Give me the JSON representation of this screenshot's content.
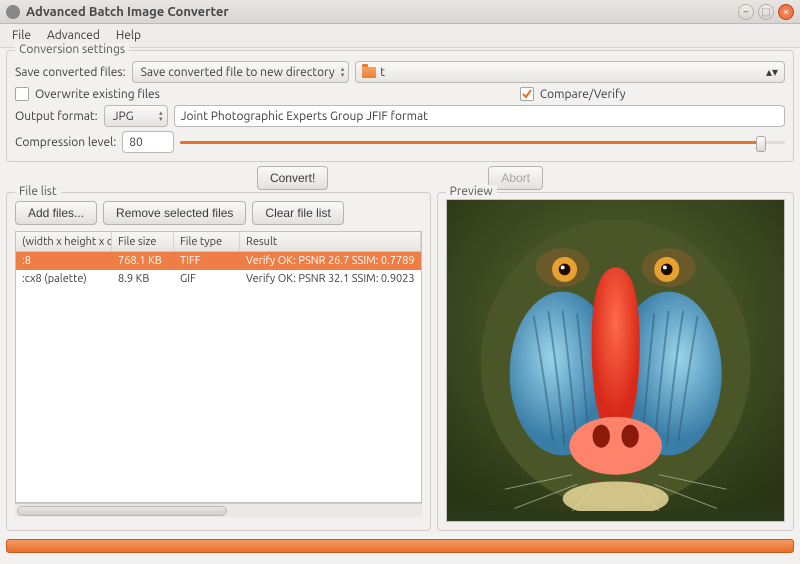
{
  "window": {
    "title": "Advanced Batch Image Converter"
  },
  "menu": {
    "file": "File",
    "advanced": "Advanced",
    "help": "Help"
  },
  "settings": {
    "legend": "Conversion settings",
    "save_label": "Save converted files:",
    "save_mode": "Save converted file to new directory",
    "path_display": "t",
    "overwrite_label": "Overwrite existing files",
    "overwrite_checked": false,
    "compare_label": "Compare/Verify",
    "compare_checked": true,
    "output_format_label": "Output format:",
    "output_format": "JPG",
    "output_format_desc": "Joint Photographic Experts Group JFIF format",
    "compression_label": "Compression level:",
    "compression_value": "80",
    "compression_percent": 96
  },
  "actions": {
    "convert": "Convert!",
    "abort": "Abort"
  },
  "filelist": {
    "legend": "File list",
    "add": "Add files...",
    "remove": "Remove selected files",
    "clear": "Clear file list",
    "headers": {
      "dims": "(width x height x col",
      "size": "File size",
      "type": "File type",
      "result": "Result"
    },
    "rows": [
      {
        "dims": ":8",
        "size": "768.1 KB",
        "type": "TIFF",
        "result": "Verify OK: PSNR 26.7 SSIM: 0.7789",
        "selected": true
      },
      {
        "dims": ":cx8 (palette)",
        "size": "8.9 KB",
        "type": "GIF",
        "result": "Verify OK: PSNR 32.1 SSIM: 0.9023",
        "selected": false
      }
    ]
  },
  "preview": {
    "legend": "Preview"
  }
}
